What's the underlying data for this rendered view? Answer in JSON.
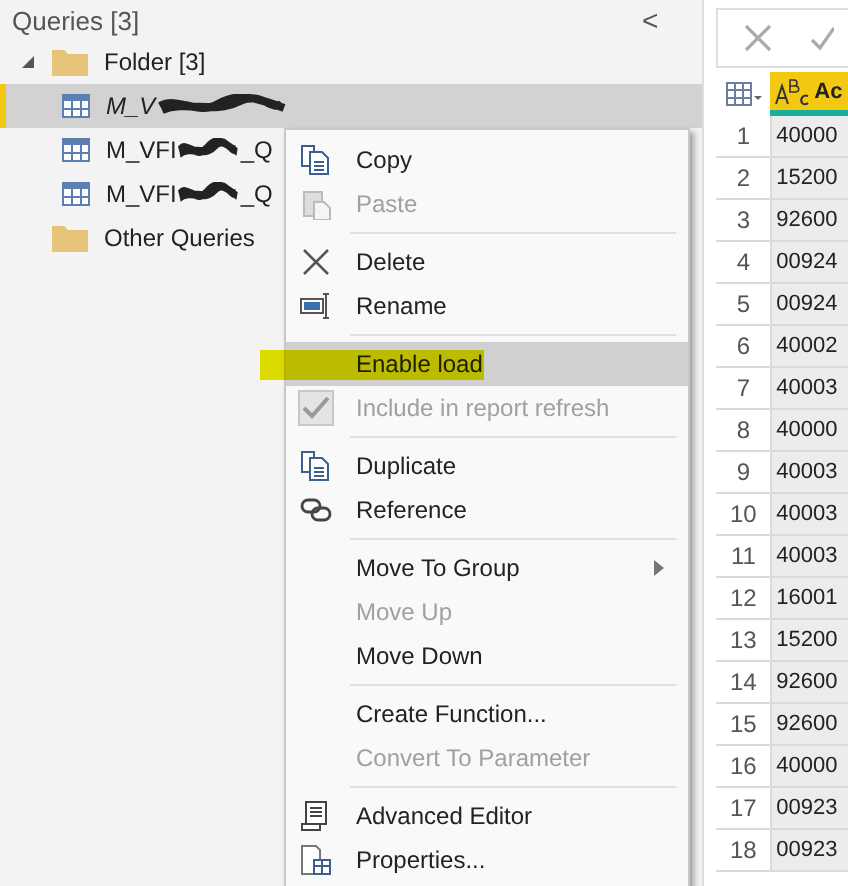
{
  "queries": {
    "title": "Queries [3]",
    "collapse": "<",
    "tree": [
      {
        "label": "Folder [3]",
        "expanded": true,
        "children": [
          {
            "label": "M_V",
            "selected": true,
            "load_enabled": false
          },
          {
            "label": "M_VFI",
            "label_end": "_Q",
            "selected": false,
            "load_enabled": true
          },
          {
            "label": "M_VFI",
            "label_end": "_Q",
            "selected": false,
            "load_enabled": true
          }
        ]
      },
      {
        "label": "Other Queries",
        "selected": false
      }
    ]
  },
  "context_menu": {
    "items": [
      {
        "kind": "item",
        "label": "Copy",
        "disabled": false,
        "highlighted": false
      },
      {
        "kind": "item",
        "label": "Paste",
        "disabled": true,
        "highlighted": false
      },
      {
        "kind": "separator"
      },
      {
        "kind": "item",
        "label": "Delete",
        "disabled": false,
        "highlighted": false
      },
      {
        "kind": "item",
        "label": "Rename",
        "disabled": false,
        "highlighted": false
      },
      {
        "kind": "separator"
      },
      {
        "kind": "item",
        "label": "Enable load",
        "disabled": false,
        "highlighted": true
      },
      {
        "kind": "check",
        "label": "Include in report refresh",
        "disabled": true,
        "highlighted": false,
        "checked": true
      },
      {
        "kind": "separator"
      },
      {
        "kind": "item",
        "label": "Duplicate",
        "disabled": false,
        "highlighted": false
      },
      {
        "kind": "item",
        "label": "Reference",
        "disabled": false,
        "highlighted": false
      },
      {
        "kind": "separator"
      },
      {
        "kind": "item",
        "label": "Move To Group",
        "disabled": false,
        "highlighted": false,
        "submenu": true
      },
      {
        "kind": "item",
        "label": "Move Up",
        "disabled": true,
        "highlighted": false
      },
      {
        "kind": "item",
        "label": "Move Down",
        "disabled": false,
        "highlighted": false
      },
      {
        "kind": "separator"
      },
      {
        "kind": "item",
        "label": "Create Function...",
        "disabled": false,
        "highlighted": false
      },
      {
        "kind": "item",
        "label": "Convert To Parameter",
        "disabled": true,
        "highlighted": false
      },
      {
        "kind": "separator"
      },
      {
        "kind": "item",
        "label": "Advanced Editor",
        "disabled": false,
        "highlighted": false
      },
      {
        "kind": "item",
        "label": "Properties...",
        "disabled": false,
        "highlighted": false
      }
    ]
  },
  "grid": {
    "column_1": "Ac",
    "rows": [
      {
        "number": "1",
        "value": "40000"
      },
      {
        "number": "2",
        "value": "15200"
      },
      {
        "number": "3",
        "value": "92600"
      },
      {
        "number": "4",
        "value": "00924"
      },
      {
        "number": "5",
        "value": "00924"
      },
      {
        "number": "6",
        "value": "40002"
      },
      {
        "number": "7",
        "value": "40003"
      },
      {
        "number": "8",
        "value": "40000"
      },
      {
        "number": "9",
        "value": "40003"
      },
      {
        "number": "10",
        "value": "40003"
      },
      {
        "number": "11",
        "value": "40003"
      },
      {
        "number": "12",
        "value": "16001"
      },
      {
        "number": "13",
        "value": "15200"
      },
      {
        "number": "14",
        "value": "92600"
      },
      {
        "number": "15",
        "value": "92600"
      },
      {
        "number": "16",
        "value": "40000"
      },
      {
        "number": "17",
        "value": "00923"
      },
      {
        "number": "18",
        "value": "00923"
      }
    ]
  }
}
